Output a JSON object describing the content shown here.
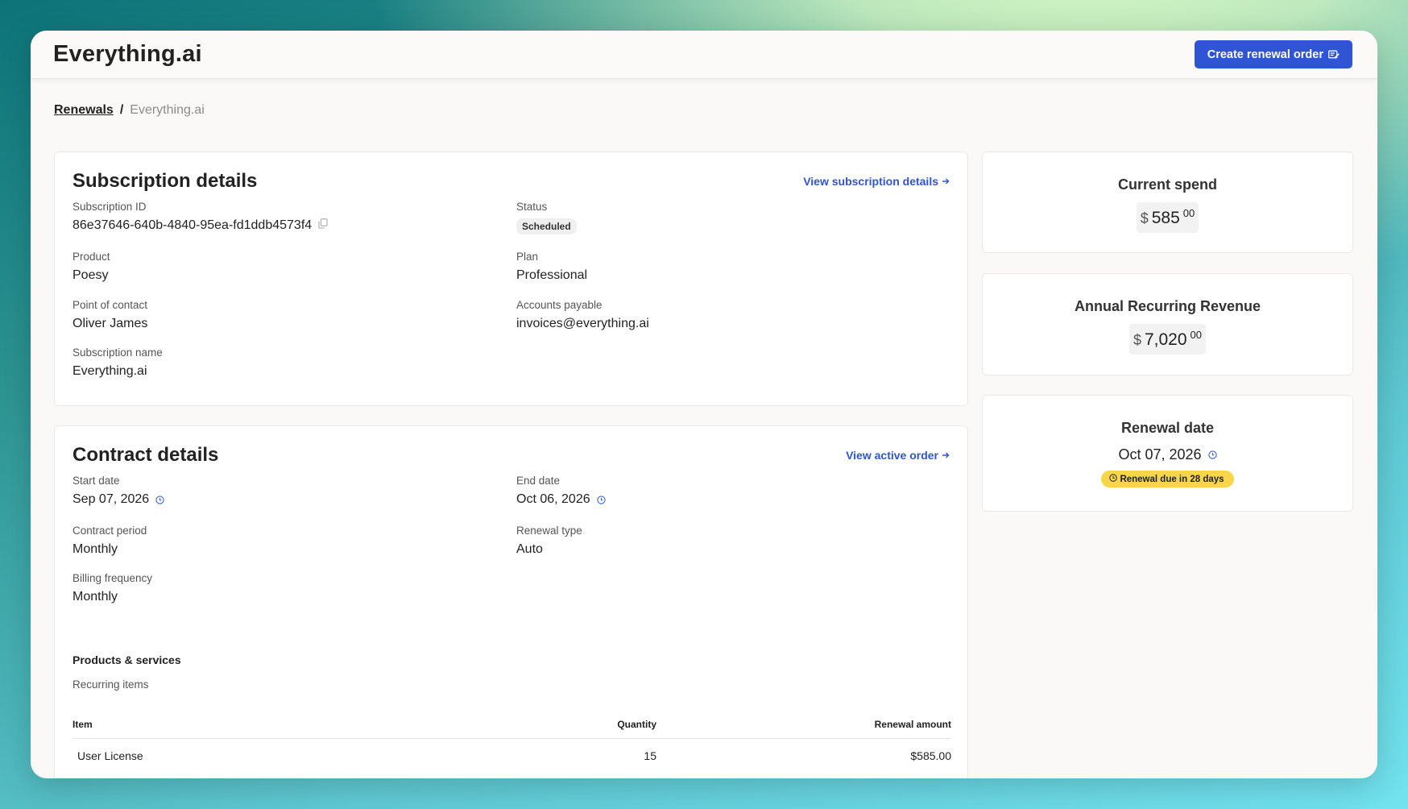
{
  "app": {
    "title": "Everything.ai"
  },
  "header": {
    "create_button_label": "Create renewal order"
  },
  "breadcrumb": {
    "parent": "Renewals",
    "separator": "/",
    "current": "Everything.ai"
  },
  "subscription": {
    "title": "Subscription details",
    "link_label": "View subscription details",
    "fields": {
      "id_label": "Subscription ID",
      "id_value": "86e37646-640b-4840-95ea-fd1ddb4573f4",
      "status_label": "Status",
      "status_value": "Scheduled",
      "product_label": "Product",
      "product_value": "Poesy",
      "plan_label": "Plan",
      "plan_value": "Professional",
      "contact_label": "Point of contact",
      "contact_value": "Oliver James",
      "ap_label": "Accounts payable",
      "ap_value": "invoices@everything.ai",
      "name_label": "Subscription name",
      "name_value": "Everything.ai"
    }
  },
  "contract": {
    "title": "Contract details",
    "link_label": "View active order",
    "fields": {
      "start_label": "Start date",
      "start_value": "Sep 07, 2026",
      "end_label": "End date",
      "end_value": "Oct 06, 2026",
      "period_label": "Contract period",
      "period_value": "Monthly",
      "renewal_type_label": "Renewal type",
      "renewal_type_value": "Auto",
      "billing_label": "Billing frequency",
      "billing_value": "Monthly"
    },
    "products": {
      "title": "Products & services",
      "subtitle": "Recurring items",
      "columns": [
        "Item",
        "Quantity",
        "Renewal amount"
      ],
      "rows": [
        {
          "item": "User License",
          "quantity": "15",
          "amount": "$585.00"
        }
      ]
    }
  },
  "stats": {
    "current_spend": {
      "title": "Current spend",
      "currency": "$",
      "amount": "585",
      "cents": "00"
    },
    "arr": {
      "title": "Annual Recurring Revenue",
      "currency": "$",
      "amount": "7,020",
      "cents": "00"
    },
    "renewal": {
      "title": "Renewal date",
      "date": "Oct 07, 2026",
      "badge": "Renewal due in 28 days"
    }
  },
  "colors": {
    "primary": "#2f55d4",
    "badge_yellow": "#f8d64a"
  }
}
